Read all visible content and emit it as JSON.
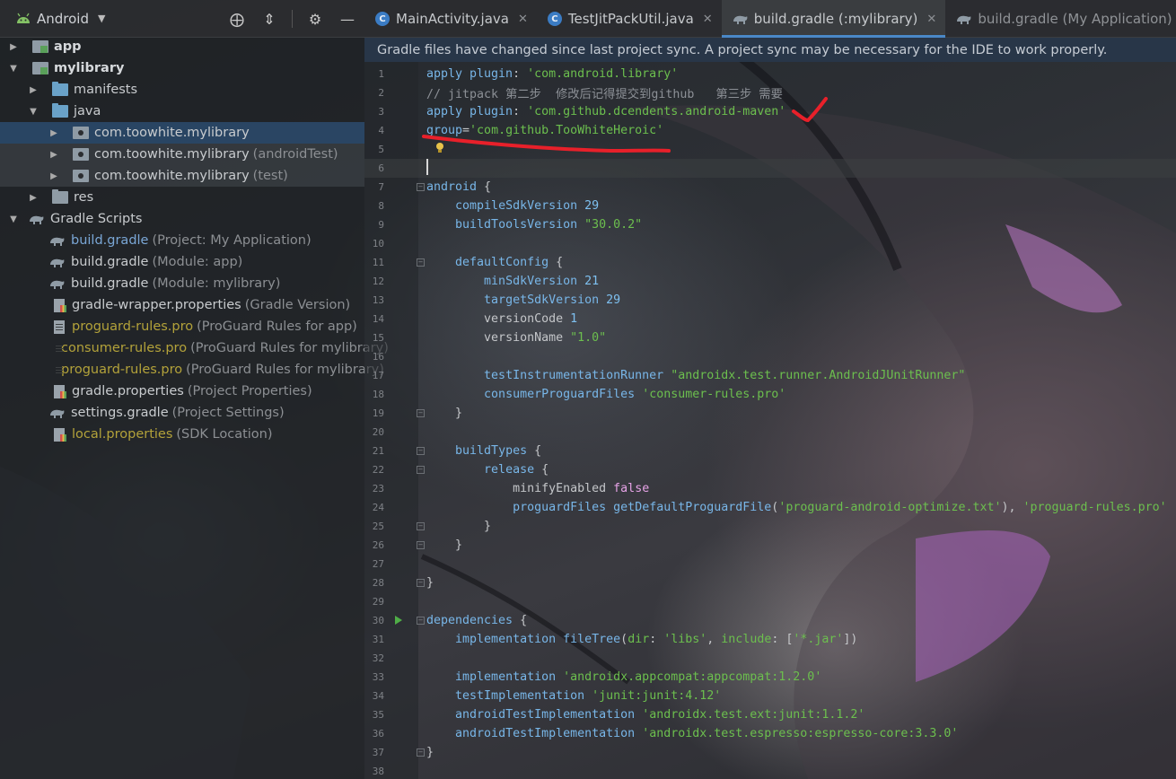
{
  "project_panel": {
    "view_mode": "Android",
    "tools": [
      "target-icon",
      "collapse-icon",
      "gear-icon",
      "minimize-icon"
    ],
    "tree": [
      {
        "label": "app",
        "hint": "",
        "style": "bold"
      },
      {
        "label": "mylibrary",
        "hint": "",
        "style": "bold"
      },
      {
        "label": "manifests",
        "hint": "",
        "style": "main"
      },
      {
        "label": "java",
        "hint": "",
        "style": "main"
      },
      {
        "label": "com.toowhite.mylibrary",
        "hint": "",
        "style": "main"
      },
      {
        "label": "com.toowhite.mylibrary",
        "hint": "(androidTest)",
        "style": "main"
      },
      {
        "label": "com.toowhite.mylibrary",
        "hint": "(test)",
        "style": "main"
      },
      {
        "label": "res",
        "hint": "",
        "style": "main"
      },
      {
        "label": "Gradle Scripts",
        "hint": "",
        "style": "main"
      },
      {
        "label": "build.gradle",
        "hint": "(Project: My Application)",
        "style": "blue"
      },
      {
        "label": "build.gradle",
        "hint": "(Module: app)",
        "style": "main"
      },
      {
        "label": "build.gradle",
        "hint": "(Module: mylibrary)",
        "style": "main"
      },
      {
        "label": "gradle-wrapper.properties",
        "hint": "(Gradle Version)",
        "style": "main"
      },
      {
        "label": "proguard-rules.pro",
        "hint": "(ProGuard Rules for app)",
        "style": "yellow"
      },
      {
        "label": "consumer-rules.pro",
        "hint": "(ProGuard Rules for mylibrary)",
        "style": "yellow"
      },
      {
        "label": "proguard-rules.pro",
        "hint": "(ProGuard Rules for mylibrary)",
        "style": "yellow"
      },
      {
        "label": "gradle.properties",
        "hint": "(Project Properties)",
        "style": "main"
      },
      {
        "label": "settings.gradle",
        "hint": "(Project Settings)",
        "style": "main"
      },
      {
        "label": "local.properties",
        "hint": "(SDK Location)",
        "style": "yellow"
      }
    ]
  },
  "tabs": [
    {
      "label": "MainActivity.java",
      "icon": "class-icon",
      "active": false
    },
    {
      "label": "TestJitPackUtil.java",
      "icon": "class-icon",
      "active": false
    },
    {
      "label": "build.gradle (:mylibrary)",
      "icon": "gradle-icon",
      "active": true
    },
    {
      "label": "build.gradle (My Application)",
      "icon": "gradle-icon",
      "active": false
    }
  ],
  "notification": "Gradle files have changed since last project sync. A project sync may be necessary for the IDE to work properly.",
  "editor": {
    "line_numbers": [
      "1",
      "2",
      "3",
      "4",
      "5",
      "6",
      "7",
      "8",
      "9",
      "10",
      "11",
      "12",
      "13",
      "14",
      "15",
      "16",
      "17",
      "18",
      "19",
      "20",
      "21",
      "22",
      "23",
      "24",
      "25",
      "26",
      "27",
      "28",
      "29",
      "30",
      "31",
      "32",
      "33",
      "34",
      "35",
      "36",
      "37",
      "38"
    ],
    "lines": [
      [
        [
          "kw",
          "apply plugin"
        ],
        [
          "p",
          ": "
        ],
        [
          "str",
          "'com.android.library'"
        ]
      ],
      [
        [
          "cmt",
          "// jitpack 第二步  修改后记得提交到github   第三步 需要"
        ]
      ],
      [
        [
          "kw",
          "apply plugin"
        ],
        [
          "p",
          ": "
        ],
        [
          "str",
          "'com.github.dcendents.android-maven'"
        ]
      ],
      [
        [
          "kw",
          "group"
        ],
        [
          "p",
          "="
        ],
        [
          "str",
          "'com.github.TooWhiteHeroic'"
        ]
      ],
      [],
      [],
      [
        [
          "kw",
          "android"
        ],
        [
          "p",
          " {"
        ]
      ],
      [
        [
          "p",
          "    "
        ],
        [
          "kw",
          "compileSdkVersion"
        ],
        [
          "p",
          " "
        ],
        [
          "num",
          "29"
        ]
      ],
      [
        [
          "p",
          "    "
        ],
        [
          "kw",
          "buildToolsVersion"
        ],
        [
          "p",
          " "
        ],
        [
          "str",
          "\"30.0.2\""
        ]
      ],
      [],
      [
        [
          "p",
          "    "
        ],
        [
          "kw",
          "defaultConfig"
        ],
        [
          "p",
          " {"
        ]
      ],
      [
        [
          "p",
          "        "
        ],
        [
          "kw",
          "minSdkVersion"
        ],
        [
          "p",
          " "
        ],
        [
          "num",
          "21"
        ]
      ],
      [
        [
          "p",
          "        "
        ],
        [
          "kw",
          "targetSdkVersion"
        ],
        [
          "p",
          " "
        ],
        [
          "num",
          "29"
        ]
      ],
      [
        [
          "p",
          "        "
        ],
        [
          "p",
          "versionCode"
        ],
        [
          "p",
          " "
        ],
        [
          "num",
          "1"
        ]
      ],
      [
        [
          "p",
          "        "
        ],
        [
          "p",
          "versionName"
        ],
        [
          "p",
          " "
        ],
        [
          "str",
          "\"1.0\""
        ]
      ],
      [],
      [
        [
          "p",
          "        "
        ],
        [
          "kw",
          "testInstrumentationRunner"
        ],
        [
          "p",
          " "
        ],
        [
          "str",
          "\"androidx.test.runner.AndroidJUnitRunner\""
        ]
      ],
      [
        [
          "p",
          "        "
        ],
        [
          "kw",
          "consumerProguardFiles"
        ],
        [
          "p",
          " "
        ],
        [
          "str",
          "'consumer-rules.pro'"
        ]
      ],
      [
        [
          "p",
          "    }"
        ]
      ],
      [],
      [
        [
          "p",
          "    "
        ],
        [
          "kw",
          "buildTypes"
        ],
        [
          "p",
          " {"
        ]
      ],
      [
        [
          "p",
          "        "
        ],
        [
          "kw",
          "release"
        ],
        [
          "p",
          " {"
        ]
      ],
      [
        [
          "p",
          "            "
        ],
        [
          "p",
          "minifyEnabled"
        ],
        [
          "p",
          " "
        ],
        [
          "bool",
          "false"
        ]
      ],
      [
        [
          "p",
          "            "
        ],
        [
          "kw",
          "proguardFiles"
        ],
        [
          "p",
          " "
        ],
        [
          "kw",
          "getDefaultProguardFile"
        ],
        [
          "p",
          "("
        ],
        [
          "str",
          "'proguard-android-optimize.txt'"
        ],
        [
          "p",
          "), "
        ],
        [
          "str",
          "'proguard-rules.pro'"
        ]
      ],
      [
        [
          "p",
          "        }"
        ]
      ],
      [
        [
          "p",
          "    }"
        ]
      ],
      [],
      [
        [
          "p",
          "}"
        ]
      ],
      [],
      [
        [
          "kw",
          "dependencies"
        ],
        [
          "p",
          " {"
        ]
      ],
      [
        [
          "p",
          "    "
        ],
        [
          "kw",
          "implementation"
        ],
        [
          "p",
          " "
        ],
        [
          "kw",
          "fileTree"
        ],
        [
          "p",
          "("
        ],
        [
          "str",
          "dir"
        ],
        [
          "p",
          ": "
        ],
        [
          "str",
          "'libs'"
        ],
        [
          "p",
          ", "
        ],
        [
          "str",
          "include"
        ],
        [
          "p",
          ": ["
        ],
        [
          "str",
          "'*.jar'"
        ],
        [
          "p",
          "])"
        ]
      ],
      [],
      [
        [
          "p",
          "    "
        ],
        [
          "kw",
          "implementation"
        ],
        [
          "p",
          " "
        ],
        [
          "str",
          "'androidx.appcompat:appcompat:1.2.0'"
        ]
      ],
      [
        [
          "p",
          "    "
        ],
        [
          "kw",
          "testImplementation"
        ],
        [
          "p",
          " "
        ],
        [
          "str",
          "'junit:junit:4.12'"
        ]
      ],
      [
        [
          "p",
          "    "
        ],
        [
          "kw",
          "androidTestImplementation"
        ],
        [
          "p",
          " "
        ],
        [
          "str",
          "'androidx.test.ext:junit:1.1.2'"
        ]
      ],
      [
        [
          "p",
          "    "
        ],
        [
          "kw",
          "androidTestImplementation"
        ],
        [
          "p",
          " "
        ],
        [
          "str",
          "'androidx.test.espresso:espresso-core:3.3.0'"
        ]
      ],
      [
        [
          "p",
          "}"
        ]
      ],
      []
    ]
  },
  "colors": {
    "keyword": "#78b6e8",
    "string": "#6cbf4e",
    "comment": "#8c9096",
    "annotation": "#e8202a",
    "tab_accent": "#4a88c7"
  }
}
